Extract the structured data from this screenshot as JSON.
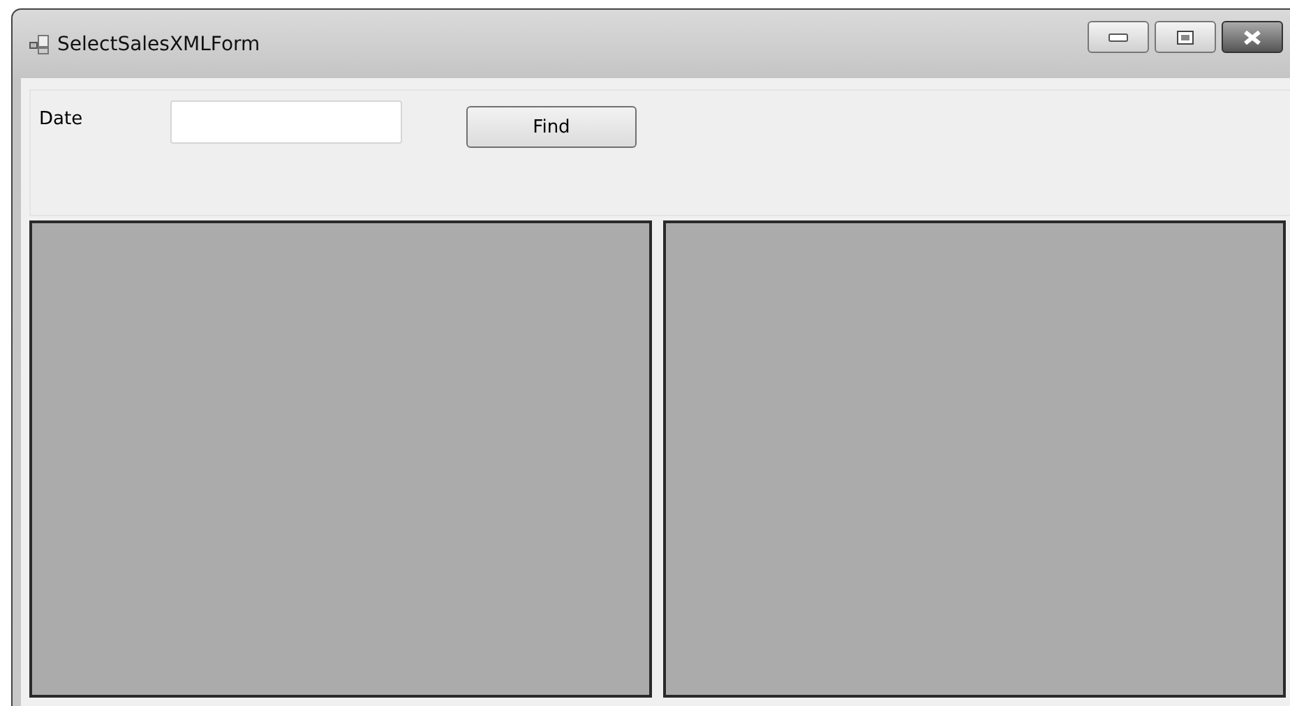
{
  "window": {
    "title": "SelectSalesXMLForm"
  },
  "toolbar": {
    "date_label": "Date",
    "find_button": "Find"
  },
  "panels": [
    {
      "kind": "empty"
    },
    {
      "kind": "empty"
    }
  ]
}
